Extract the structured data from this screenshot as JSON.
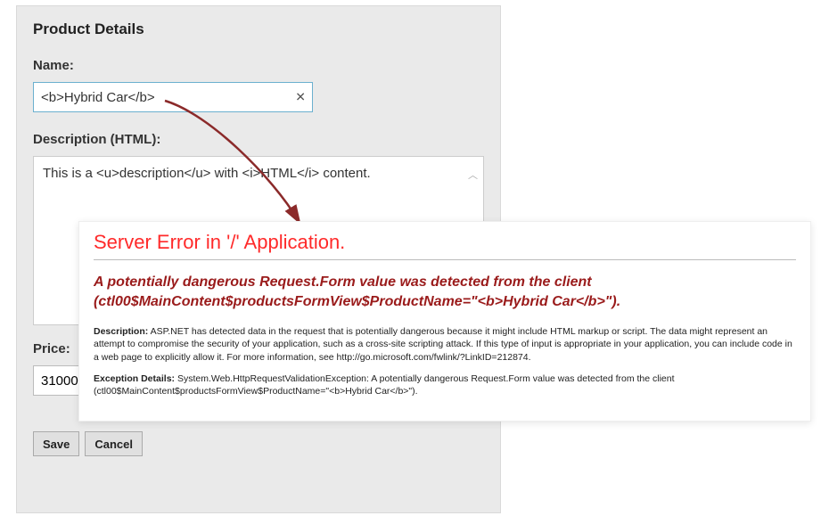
{
  "panel": {
    "title": "Product Details",
    "name_label": "Name:",
    "name_value": "<b>Hybrid Car</b>",
    "description_label": "Description (HTML):",
    "description_value": "This is a <u>description</u> with <i>HTML</i> content.",
    "price_label": "Price:",
    "price_value": "31000.0",
    "save_label": "Save",
    "cancel_label": "Cancel"
  },
  "error": {
    "title": "Server Error in '/' Application.",
    "subtitle": "A potentially dangerous Request.Form value was detected from the client (ctl00$MainContent$productsFormView$ProductName=\"<b>Hybrid Car</b>\").",
    "description_label": "Description:",
    "description_text": " ASP.NET has detected data in the request that is potentially dangerous because it might include HTML markup or script. The data might represent an attempt to compromise the security of your application, such as a cross-site scripting attack. If this type of input is appropriate in your application, you can include code in a web page to explicitly allow it. For more information, see http://go.microsoft.com/fwlink/?LinkID=212874.",
    "exception_label": "Exception Details:",
    "exception_text": " System.Web.HttpRequestValidationException: A potentially dangerous Request.Form value was detected from the client (ctl00$MainContent$productsFormView$ProductName=\"<b>Hybrid Car</b>\")."
  }
}
